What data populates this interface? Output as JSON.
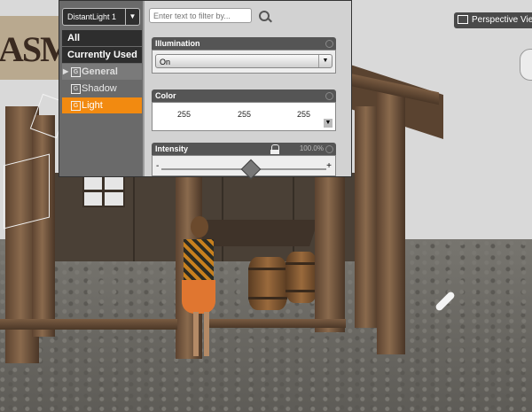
{
  "viewport": {
    "camera_label": "Perspective View",
    "sign_text": "ASM"
  },
  "panel": {
    "node_selector": "DistantLight 1",
    "node_selector_arrow": "▼",
    "filter_placeholder": "Enter text to filter by...",
    "categories": [
      "All",
      "Currently Used"
    ],
    "groups": [
      {
        "label": "General",
        "icon": "G",
        "expanded_arrow": "▶"
      },
      {
        "label": "Shadow",
        "icon": "G"
      },
      {
        "label": "Light",
        "icon": "G",
        "selected": true
      }
    ],
    "properties": {
      "illumination": {
        "label": "Illumination",
        "value": "On",
        "arrow": "▼"
      },
      "color": {
        "label": "Color",
        "r": "255",
        "g": "255",
        "b": "255",
        "arrow": "▼"
      },
      "intensity": {
        "label": "Intensity",
        "percent_text": "100.0%",
        "minus": "-",
        "plus": "+",
        "value_fraction": 0.54
      }
    }
  },
  "colors": {
    "accent": "#f28a10"
  }
}
